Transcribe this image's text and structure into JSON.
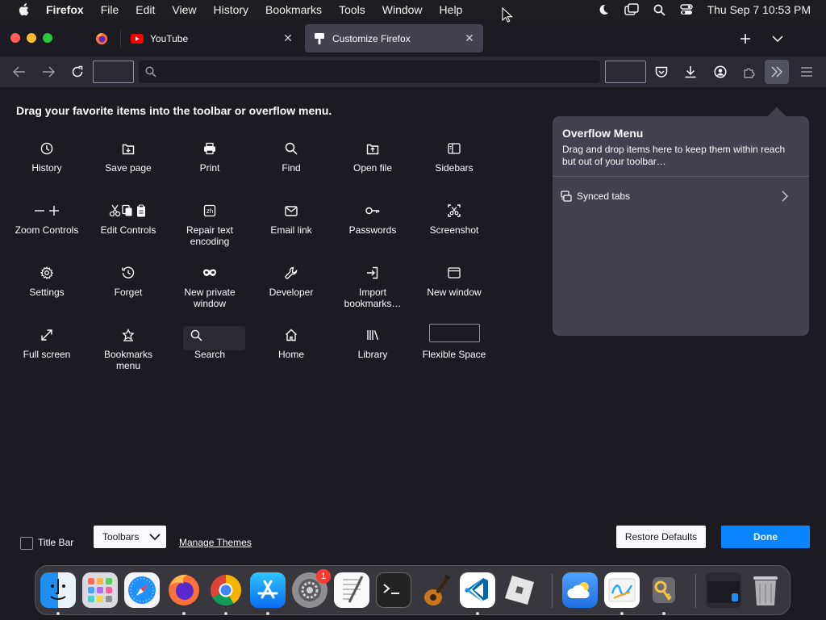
{
  "menubar": {
    "app_name": "Firefox",
    "items": [
      "File",
      "Edit",
      "View",
      "History",
      "Bookmarks",
      "Tools",
      "Window",
      "Help"
    ],
    "clock": "Thu Sep 7  10:53 PM"
  },
  "tabs": [
    {
      "label": "",
      "icon": "firefox-icon"
    },
    {
      "label": "YouTube",
      "icon": "youtube-icon"
    },
    {
      "label": "Customize Firefox",
      "icon": "customize-icon",
      "active": true
    }
  ],
  "customize": {
    "instructions": "Drag your favorite items into the toolbar or overflow menu.",
    "items": [
      {
        "label": "History",
        "icon": "history-icon"
      },
      {
        "label": "Save page",
        "icon": "save-page-icon"
      },
      {
        "label": "Print",
        "icon": "print-icon"
      },
      {
        "label": "Find",
        "icon": "find-icon"
      },
      {
        "label": "Open file",
        "icon": "open-file-icon"
      },
      {
        "label": "Sidebars",
        "icon": "sidebars-icon"
      },
      {
        "label": "Zoom Controls",
        "icon": "zoom-controls-icon"
      },
      {
        "label": "Edit Controls",
        "icon": "edit-controls-icon"
      },
      {
        "label": "Repair text encoding",
        "icon": "text-encoding-icon"
      },
      {
        "label": "Email link",
        "icon": "email-icon"
      },
      {
        "label": "Passwords",
        "icon": "key-icon"
      },
      {
        "label": "Screenshot",
        "icon": "screenshot-icon"
      },
      {
        "label": "Settings",
        "icon": "gear-icon"
      },
      {
        "label": "Forget",
        "icon": "forget-icon"
      },
      {
        "label": "New private window",
        "icon": "private-mask-icon"
      },
      {
        "label": "Developer",
        "icon": "wrench-icon"
      },
      {
        "label": "Import bookmarks…",
        "icon": "import-icon"
      },
      {
        "label": "New window",
        "icon": "new-window-icon"
      },
      {
        "label": "Full screen",
        "icon": "fullscreen-icon"
      },
      {
        "label": "Bookmarks menu",
        "icon": "bookmarks-star-icon"
      },
      {
        "label": "Search",
        "icon": "search-icon"
      },
      {
        "label": "Home",
        "icon": "home-icon"
      },
      {
        "label": "Library",
        "icon": "library-icon"
      },
      {
        "label": "Flexible Space",
        "icon": "flexible-space-icon"
      }
    ]
  },
  "overflow_menu": {
    "title": "Overflow Menu",
    "description": "Drag and drop items here to keep them within reach but out of your toolbar…",
    "synced_tabs": "Synced tabs"
  },
  "footer": {
    "title_bar": "Title Bar",
    "toolbars": "Toolbars",
    "manage_themes": "Manage Themes",
    "restore_defaults": "Restore Defaults",
    "done": "Done"
  },
  "dock": {
    "apps": [
      "Finder",
      "Launchpad",
      "Safari",
      "Firefox",
      "Chrome",
      "App Store",
      "System Settings",
      "TextEdit",
      "Terminal",
      "GarageBand",
      "VS Code",
      "Roblox",
      "Weather",
      "Freeform",
      "Keychain Access",
      "Window Preview",
      "Trash"
    ],
    "settings_badge": "1"
  },
  "colors": {
    "accent": "#0a84ff",
    "toolbar": "#2b2a33",
    "background": "#1c1b22",
    "panel": "#42414d"
  }
}
